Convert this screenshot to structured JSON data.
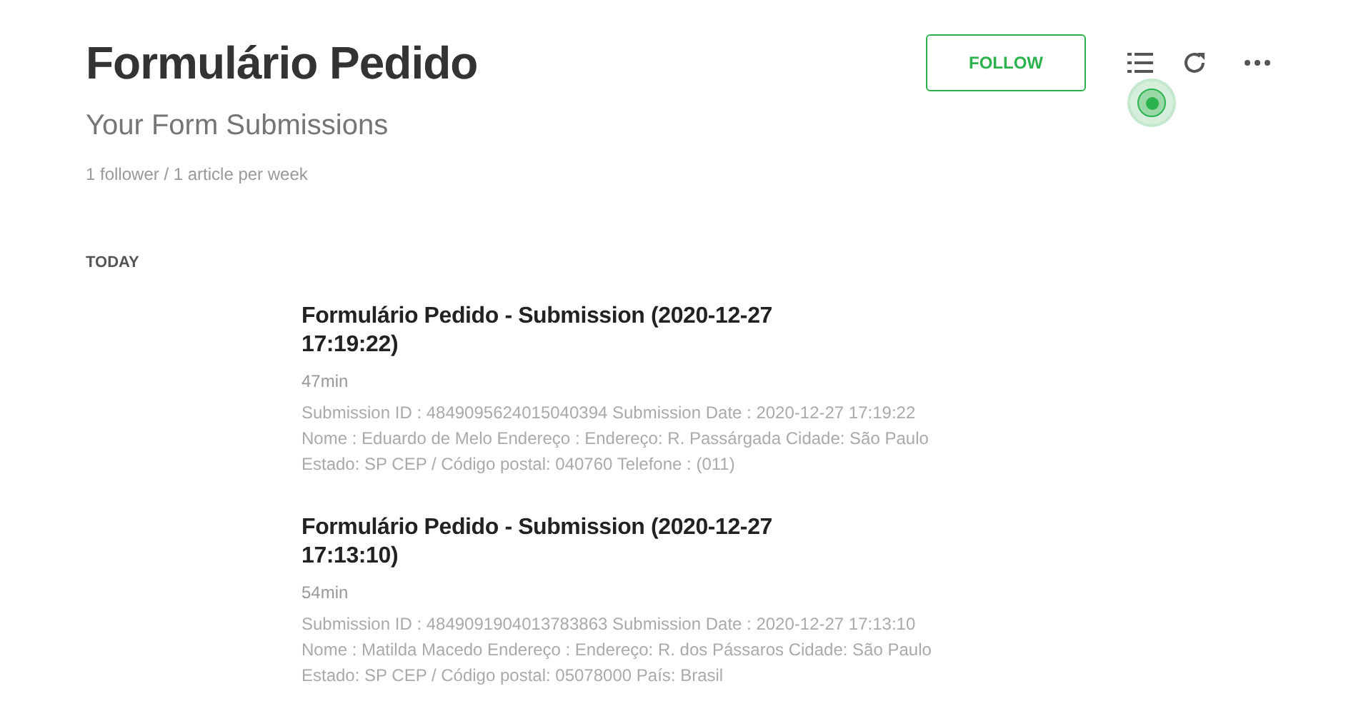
{
  "header": {
    "title": "Formulário Pedido",
    "subtitle": "Your Form Submissions",
    "stats": "1 follower / 1 article per week",
    "follow_button": "FOLLOW"
  },
  "section": "TODAY",
  "entries": [
    {
      "title": "Formulário Pedido - Submission (2020-12-27 17:19:22)",
      "age": "47min",
      "summary": "Submission ID : 4849095624015040394 Submission Date : 2020-12-27 17:19:22 Nome : Eduardo de Melo Endereço : Endereço: R. Passárgada Cidade: São Paulo Estado: SP CEP / Código postal: 040760 Telefone : (011)"
    },
    {
      "title": "Formulário Pedido - Submission (2020-12-27 17:13:10)",
      "age": "54min",
      "summary": "Submission ID : 4849091904013783863 Submission Date : 2020-12-27 17:13:10 Nome : Matilda Macedo Endereço : Endereço: R. dos Pássaros Cidade: São Paulo Estado: SP CEP / Código postal: 05078000 País: Brasil"
    }
  ]
}
